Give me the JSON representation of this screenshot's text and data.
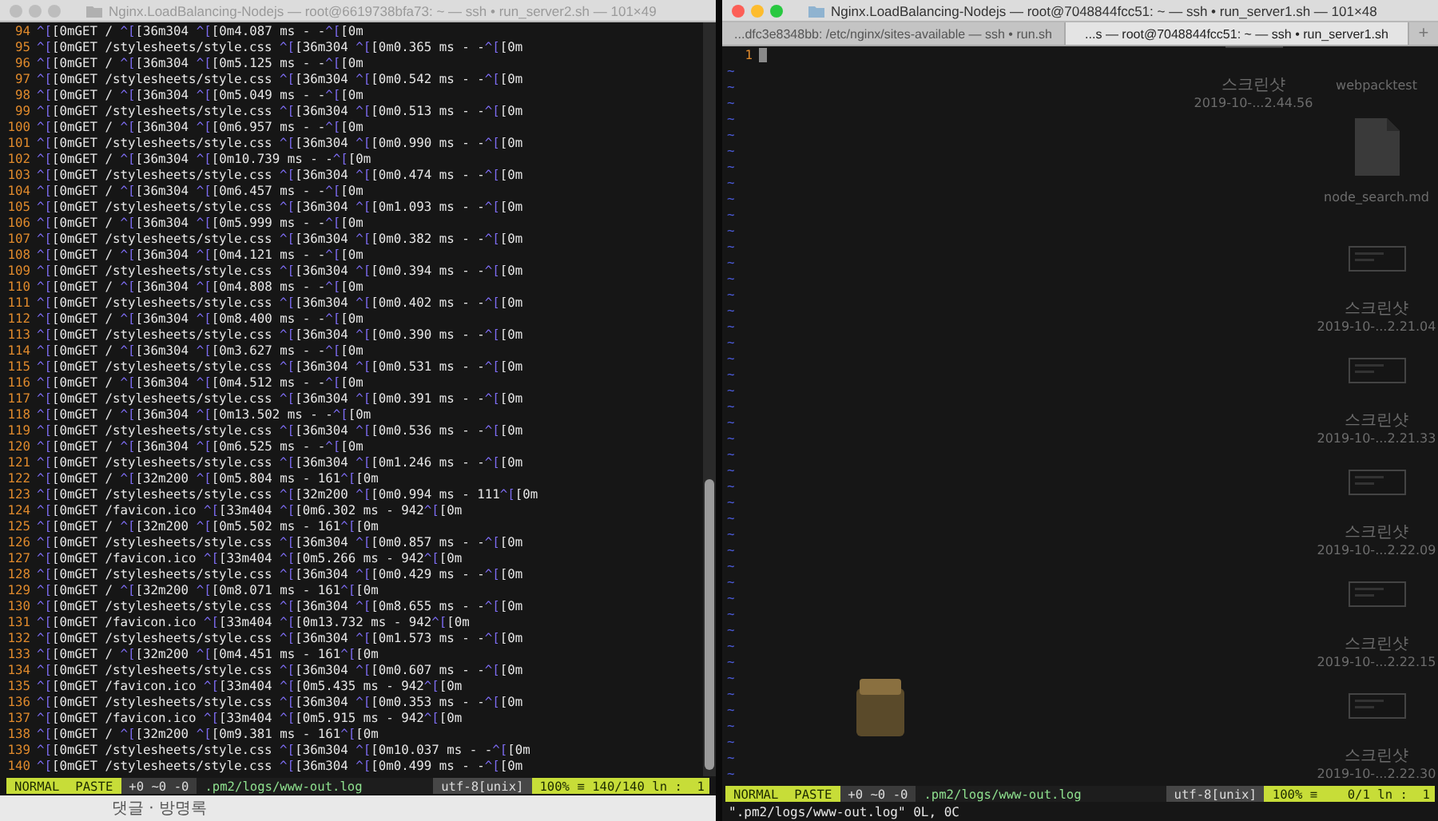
{
  "windows": [
    {
      "active": false,
      "title": "Nginx.LoadBalancing-Nodejs — root@6619738bfa73: ~ — ssh • run_server2.sh — 101×49",
      "lines": [
        {
          "number": "94",
          "text": "^[[0mGET / ^[[36m304 ^[[0m4.087 ms - -^[[0m"
        },
        {
          "number": "95",
          "text": "^[[0mGET /stylesheets/style.css ^[[36m304 ^[[0m0.365 ms - -^[[0m"
        },
        {
          "number": "96",
          "text": "^[[0mGET / ^[[36m304 ^[[0m5.125 ms - -^[[0m"
        },
        {
          "number": "97",
          "text": "^[[0mGET /stylesheets/style.css ^[[36m304 ^[[0m0.542 ms - -^[[0m"
        },
        {
          "number": "98",
          "text": "^[[0mGET / ^[[36m304 ^[[0m5.049 ms - -^[[0m"
        },
        {
          "number": "99",
          "text": "^[[0mGET /stylesheets/style.css ^[[36m304 ^[[0m0.513 ms - -^[[0m"
        },
        {
          "number": "100",
          "text": "^[[0mGET / ^[[36m304 ^[[0m6.957 ms - -^[[0m"
        },
        {
          "number": "101",
          "text": "^[[0mGET /stylesheets/style.css ^[[36m304 ^[[0m0.990 ms - -^[[0m"
        },
        {
          "number": "102",
          "text": "^[[0mGET / ^[[36m304 ^[[0m10.739 ms - -^[[0m"
        },
        {
          "number": "103",
          "text": "^[[0mGET /stylesheets/style.css ^[[36m304 ^[[0m0.474 ms - -^[[0m"
        },
        {
          "number": "104",
          "text": "^[[0mGET / ^[[36m304 ^[[0m6.457 ms - -^[[0m"
        },
        {
          "number": "105",
          "text": "^[[0mGET /stylesheets/style.css ^[[36m304 ^[[0m1.093 ms - -^[[0m"
        },
        {
          "number": "106",
          "text": "^[[0mGET / ^[[36m304 ^[[0m5.999 ms - -^[[0m"
        },
        {
          "number": "107",
          "text": "^[[0mGET /stylesheets/style.css ^[[36m304 ^[[0m0.382 ms - -^[[0m"
        },
        {
          "number": "108",
          "text": "^[[0mGET / ^[[36m304 ^[[0m4.121 ms - -^[[0m"
        },
        {
          "number": "109",
          "text": "^[[0mGET /stylesheets/style.css ^[[36m304 ^[[0m0.394 ms - -^[[0m"
        },
        {
          "number": "110",
          "text": "^[[0mGET / ^[[36m304 ^[[0m4.808 ms - -^[[0m"
        },
        {
          "number": "111",
          "text": "^[[0mGET /stylesheets/style.css ^[[36m304 ^[[0m0.402 ms - -^[[0m"
        },
        {
          "number": "112",
          "text": "^[[0mGET / ^[[36m304 ^[[0m8.400 ms - -^[[0m"
        },
        {
          "number": "113",
          "text": "^[[0mGET /stylesheets/style.css ^[[36m304 ^[[0m0.390 ms - -^[[0m"
        },
        {
          "number": "114",
          "text": "^[[0mGET / ^[[36m304 ^[[0m3.627 ms - -^[[0m"
        },
        {
          "number": "115",
          "text": "^[[0mGET /stylesheets/style.css ^[[36m304 ^[[0m0.531 ms - -^[[0m"
        },
        {
          "number": "116",
          "text": "^[[0mGET / ^[[36m304 ^[[0m4.512 ms - -^[[0m"
        },
        {
          "number": "117",
          "text": "^[[0mGET /stylesheets/style.css ^[[36m304 ^[[0m0.391 ms - -^[[0m"
        },
        {
          "number": "118",
          "text": "^[[0mGET / ^[[36m304 ^[[0m13.502 ms - -^[[0m"
        },
        {
          "number": "119",
          "text": "^[[0mGET /stylesheets/style.css ^[[36m304 ^[[0m0.536 ms - -^[[0m"
        },
        {
          "number": "120",
          "text": "^[[0mGET / ^[[36m304 ^[[0m6.525 ms - -^[[0m"
        },
        {
          "number": "121",
          "text": "^[[0mGET /stylesheets/style.css ^[[36m304 ^[[0m1.246 ms - -^[[0m"
        },
        {
          "number": "122",
          "text": "^[[0mGET / ^[[32m200 ^[[0m5.804 ms - 161^[[0m"
        },
        {
          "number": "123",
          "text": "^[[0mGET /stylesheets/style.css ^[[32m200 ^[[0m0.994 ms - 111^[[0m"
        },
        {
          "number": "124",
          "text": "^[[0mGET /favicon.ico ^[[33m404 ^[[0m6.302 ms - 942^[[0m"
        },
        {
          "number": "125",
          "text": "^[[0mGET / ^[[32m200 ^[[0m5.502 ms - 161^[[0m"
        },
        {
          "number": "126",
          "text": "^[[0mGET /stylesheets/style.css ^[[36m304 ^[[0m0.857 ms - -^[[0m"
        },
        {
          "number": "127",
          "text": "^[[0mGET /favicon.ico ^[[33m404 ^[[0m5.266 ms - 942^[[0m"
        },
        {
          "number": "128",
          "text": "^[[0mGET /stylesheets/style.css ^[[36m304 ^[[0m0.429 ms - -^[[0m"
        },
        {
          "number": "129",
          "text": "^[[0mGET / ^[[32m200 ^[[0m8.071 ms - 161^[[0m"
        },
        {
          "number": "130",
          "text": "^[[0mGET /stylesheets/style.css ^[[36m304 ^[[0m8.655 ms - -^[[0m"
        },
        {
          "number": "131",
          "text": "^[[0mGET /favicon.ico ^[[33m404 ^[[0m13.732 ms - 942^[[0m"
        },
        {
          "number": "132",
          "text": "^[[0mGET /stylesheets/style.css ^[[36m304 ^[[0m1.573 ms - -^[[0m"
        },
        {
          "number": "133",
          "text": "^[[0mGET / ^[[32m200 ^[[0m4.451 ms - 161^[[0m"
        },
        {
          "number": "134",
          "text": "^[[0mGET /stylesheets/style.css ^[[36m304 ^[[0m0.607 ms - -^[[0m"
        },
        {
          "number": "135",
          "text": "^[[0mGET /favicon.ico ^[[33m404 ^[[0m5.435 ms - 942^[[0m"
        },
        {
          "number": "136",
          "text": "^[[0mGET /stylesheets/style.css ^[[36m304 ^[[0m0.353 ms - -^[[0m"
        },
        {
          "number": "137",
          "text": "^[[0mGET /favicon.ico ^[[33m404 ^[[0m5.915 ms - 942^[[0m"
        },
        {
          "number": "138",
          "text": "^[[0mGET / ^[[32m200 ^[[0m9.381 ms - 161^[[0m"
        },
        {
          "number": "139",
          "text": "^[[0mGET /stylesheets/style.css ^[[36m304 ^[[0m10.037 ms - -^[[0m"
        },
        {
          "number": "140",
          "text": "^[[0mGET /stylesheets/style.css ^[[36m304 ^[[0m0.499 ms - -^[[0m"
        }
      ],
      "status_bar": [
        {
          "kind": "mode",
          "text": "NORMAL"
        },
        {
          "kind": "mode",
          "text": "PASTE"
        },
        {
          "kind": "info",
          "text": "+0 ~0 -0"
        },
        {
          "kind": "file",
          "text": ".pm2/logs/www-out.log"
        },
        {
          "kind": "encoding",
          "text": "utf-8[unix]"
        },
        {
          "kind": "position",
          "text": "100% ≡ 140/140 ln :  1"
        }
      ]
    },
    {
      "active": true,
      "title": "Nginx.LoadBalancing-Nodejs — root@7048844fcc51: ~ — ssh • run_server1.sh — 101×48",
      "tabs": [
        {
          "label": "...dfc3e8348bb: /etc/nginx/sites-available — ssh • run.sh",
          "selected": false
        },
        {
          "label": "...s — root@7048844fcc51: ~ — ssh • run_server1.sh",
          "selected": true
        }
      ],
      "new_tab": "+",
      "lines": [
        {
          "number": "1"
        }
      ],
      "cursor": true,
      "filler_lines": [
        "~",
        "~",
        "~",
        "~",
        "~",
        "~",
        "~",
        "~",
        "~",
        "~",
        "~",
        "~",
        "~",
        "~",
        "~",
        "~",
        "~",
        "~",
        "~",
        "~",
        "~",
        "~",
        "~",
        "~",
        "~",
        "~",
        "~",
        "~",
        "~",
        "~",
        "~",
        "~",
        "~",
        "~",
        "~",
        "~",
        "~",
        "~",
        "~",
        "~",
        "~",
        "~",
        "~",
        "~",
        "~"
      ],
      "status_bar": [
        {
          "kind": "mode",
          "text": "NORMAL"
        },
        {
          "kind": "mode",
          "text": "PASTE"
        },
        {
          "kind": "info",
          "text": "+0 ~0 -0"
        },
        {
          "kind": "file",
          "text": ".pm2/logs/www-out.log"
        },
        {
          "kind": "encoding",
          "text": "utf-8[unix]"
        },
        {
          "kind": "position",
          "text": "100% ≡    0/1 ln :  1"
        }
      ],
      "command_line": "\".pm2/logs/www-out.log\" 0L, 0C",
      "desktop": {
        "columns": [
          [
            {
              "kind": "image",
              "label": [
                "스크린샷",
                "2019-10-...2.44.56"
              ]
            }
          ],
          [
            {
              "kind": "folder",
              "label": [
                "webpacktest"
              ]
            },
            {
              "kind": "document",
              "label": [
                "node_search.md"
              ]
            },
            {
              "kind": "image",
              "label": [
                "스크린샷",
                "2019-10-...2.21.04"
              ]
            },
            {
              "kind": "image",
              "label": [
                "스크린샷",
                "2019-10-...2.21.33"
              ]
            },
            {
              "kind": "image",
              "label": [
                "스크린샷",
                "2019-10-...2.22.09"
              ]
            },
            {
              "kind": "image",
              "label": [
                "스크린샷",
                "2019-10-...2.22.15"
              ]
            },
            {
              "kind": "image",
              "label": [
                "스크린샷",
                "2019-10-...2.22.30"
              ]
            }
          ]
        ]
      }
    }
  ],
  "background_text": "댓글 · 방명록"
}
